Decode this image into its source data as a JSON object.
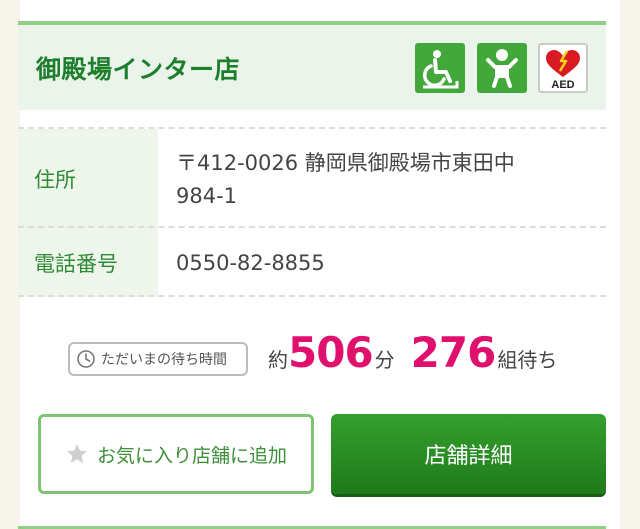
{
  "store": {
    "name": "御殿場インター店"
  },
  "amenities": [
    {
      "icon": "wheelchair-accessible-icon"
    },
    {
      "icon": "baby-changing-icon"
    },
    {
      "icon": "aed-icon",
      "label": "AED"
    }
  ],
  "info": {
    "address_label": "住所",
    "address_line1": "〒412-0026 静岡県御殿場市東田中",
    "address_line2": "984-1",
    "phone_label": "電話番号",
    "phone_value": "0550-82-8855"
  },
  "wait": {
    "badge_label": "ただいまの待ち時間",
    "approx": "約",
    "minutes": "506",
    "minutes_unit": "分",
    "groups": "276",
    "groups_unit": "組待ち"
  },
  "buttons": {
    "favorite_label": "お気に入り店舗に追加",
    "detail_label": "店舗詳細"
  },
  "colors": {
    "brand_green": "#1d7f2c",
    "accent_pink": "#e0106e"
  }
}
